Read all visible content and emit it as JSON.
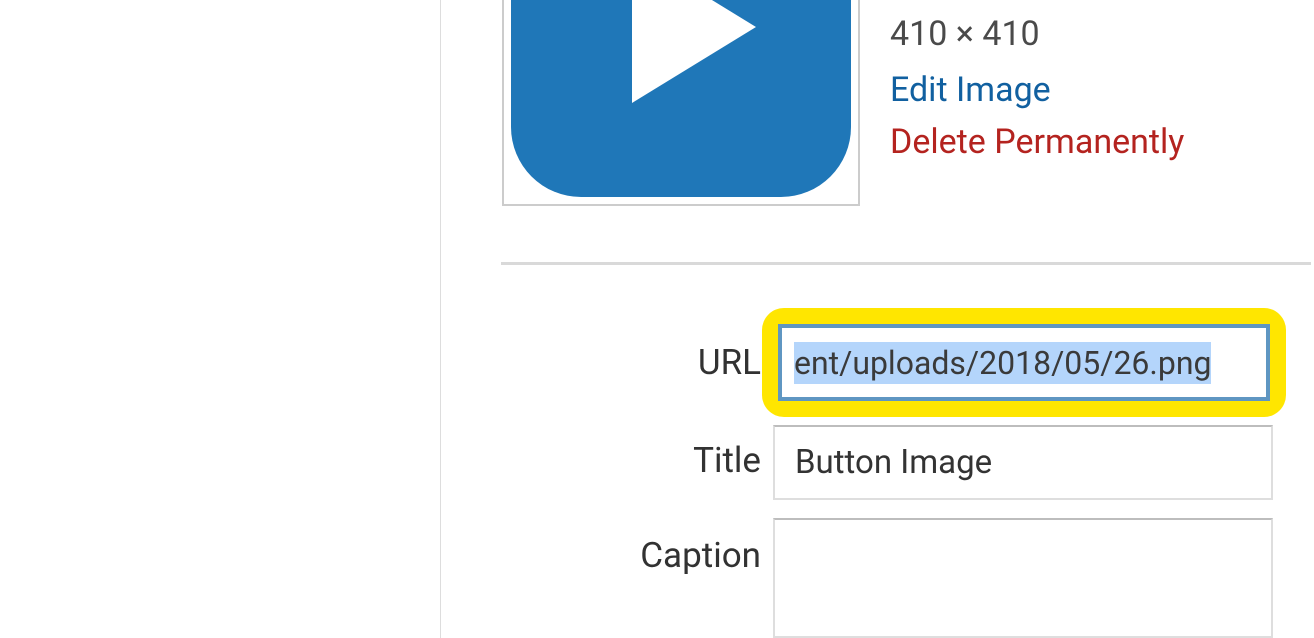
{
  "thumbnail": {
    "icon": "play-icon"
  },
  "meta": {
    "dimensions": "410 × 410",
    "edit_label": "Edit Image",
    "delete_label": "Delete Permanently"
  },
  "fields": {
    "url": {
      "label": "URL",
      "value": "ent/uploads/2018/05/26.png"
    },
    "title": {
      "label": "Title",
      "value": "Button Image"
    },
    "caption": {
      "label": "Caption",
      "value": ""
    }
  }
}
